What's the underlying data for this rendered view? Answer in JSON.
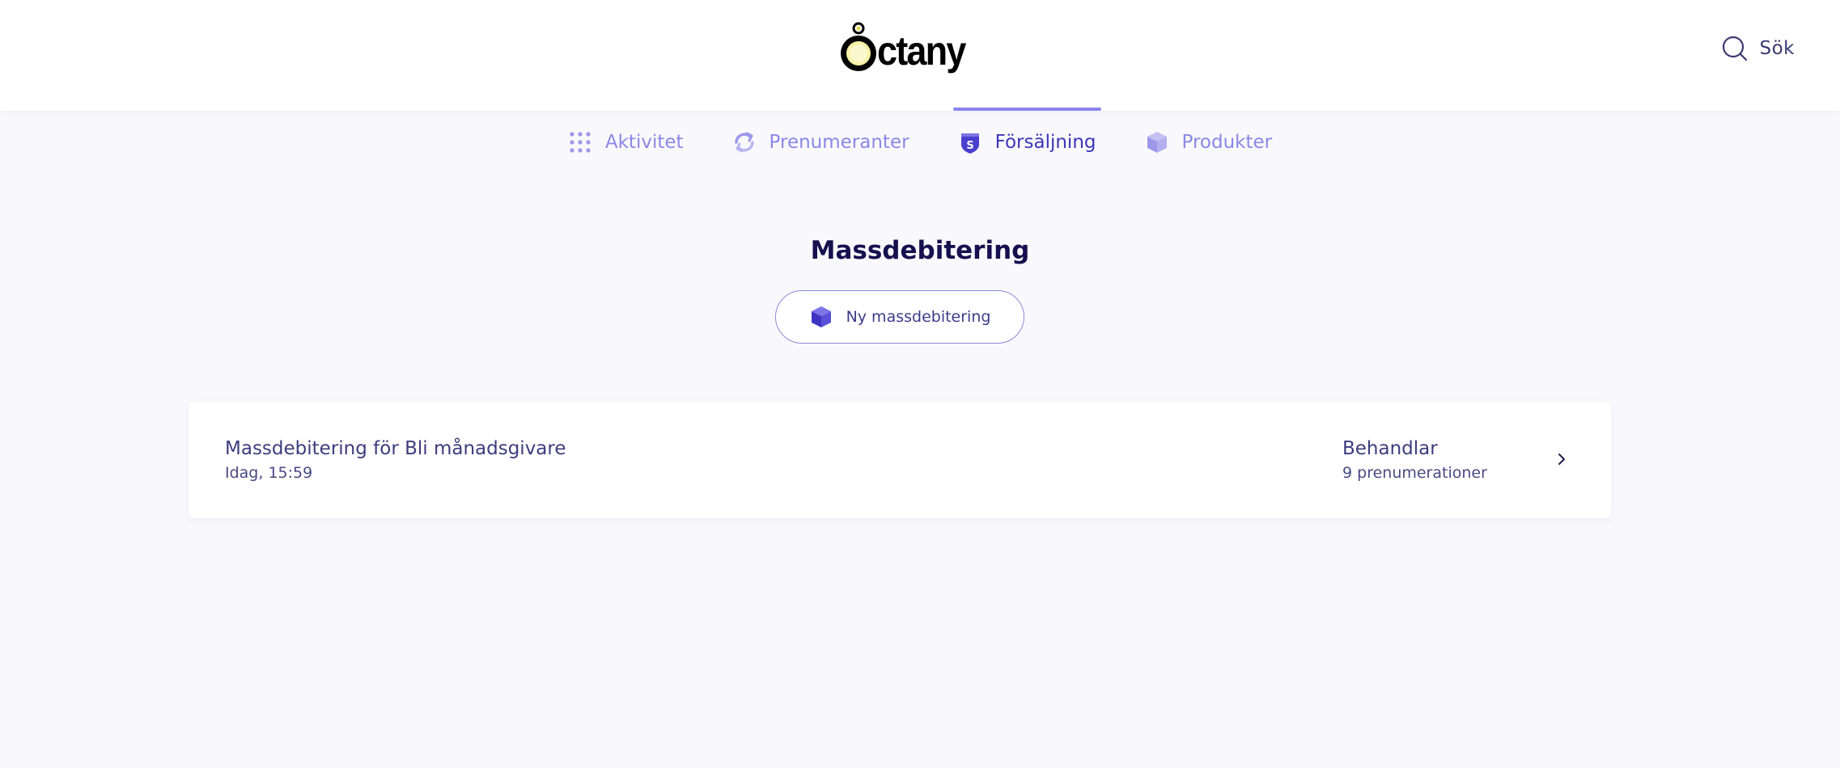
{
  "header": {
    "logo_text": "ctany",
    "search_label": "Sök"
  },
  "tabs": [
    {
      "label": "Aktivitet",
      "icon": "grid-dots-icon",
      "active": false
    },
    {
      "label": "Prenumeranter",
      "icon": "refresh-icon",
      "active": false
    },
    {
      "label": "Försäljning",
      "icon": "shield-dollar-icon",
      "active": true
    },
    {
      "label": "Produkter",
      "icon": "box-icon",
      "active": false
    }
  ],
  "main": {
    "title": "Massdebitering",
    "new_button_label": "Ny massdebitering"
  },
  "list": [
    {
      "name": "Massdebitering för Bli månadsgivare",
      "date": "Idag, 15:59",
      "status": "Behandlar",
      "count": "9 prenumerationer"
    }
  ],
  "colors": {
    "accent": "#3d36b8",
    "tab_inactive": "#8b87e6",
    "background": "#f9f9fd"
  }
}
